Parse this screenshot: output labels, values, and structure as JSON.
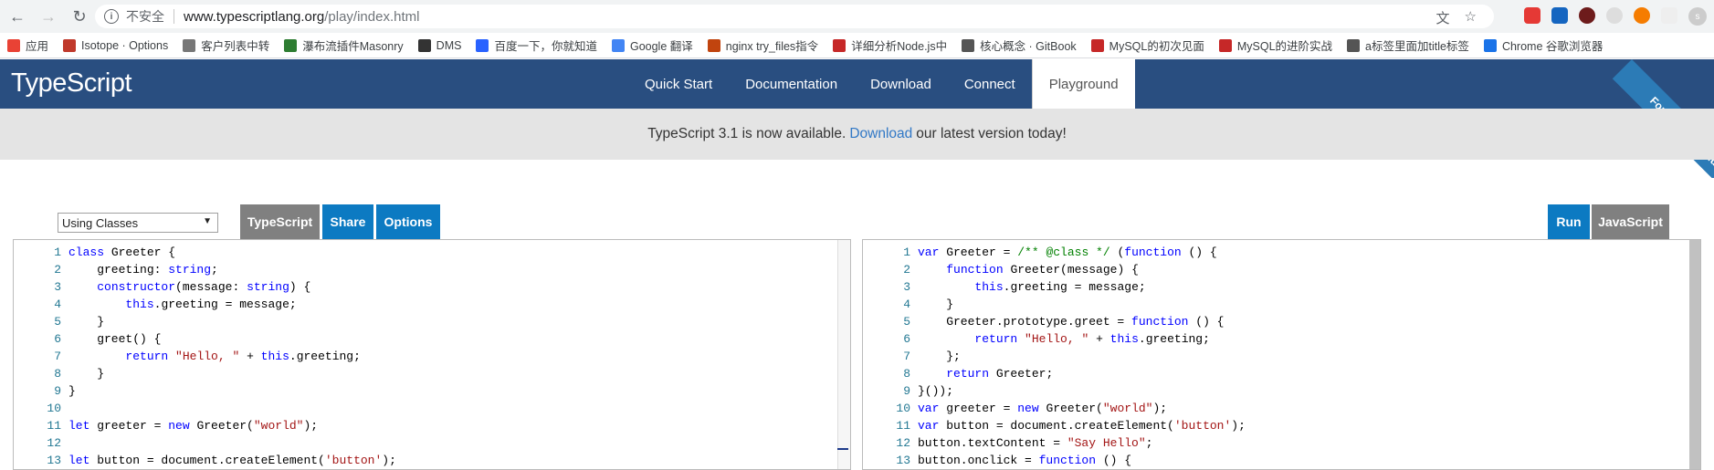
{
  "browser": {
    "insecure_label": "不安全",
    "url_host": "www.typescriptlang.org",
    "url_path": "/play/index.html",
    "avatar_letter": "s"
  },
  "bookmarks": [
    {
      "label": "应用",
      "color": "#e94235"
    },
    {
      "label": "Isotope · Options",
      "color": "#c0392b"
    },
    {
      "label": "客户列表中转",
      "color": "#777777"
    },
    {
      "label": "瀑布流插件Masonry",
      "color": "#2e7d32"
    },
    {
      "label": "DMS",
      "color": "#333333"
    },
    {
      "label": "百度一下，你就知道",
      "color": "#2962ff"
    },
    {
      "label": "Google 翻译",
      "color": "#4285f4"
    },
    {
      "label": "nginx try_files指令",
      "color": "#c1440e"
    },
    {
      "label": "详细分析Node.js中",
      "color": "#c62828"
    },
    {
      "label": "核心概念 · GitBook",
      "color": "#555555"
    },
    {
      "label": "MySQL的初次见面",
      "color": "#c62828"
    },
    {
      "label": "MySQL的进阶实战",
      "color": "#c62828"
    },
    {
      "label": "a标签里面加title标签",
      "color": "#555555"
    },
    {
      "label": "Chrome 谷歌浏览器",
      "color": "#1a73e8"
    }
  ],
  "site": {
    "logo": "TypeScript",
    "nav": [
      "Quick Start",
      "Documentation",
      "Download",
      "Connect",
      "Playground"
    ],
    "fork_ribbon": "Fork me on GitHub"
  },
  "announcement": {
    "before": "TypeScript 3.1 is now available.",
    "link": "Download",
    "after": "our latest version today!"
  },
  "toolbar": {
    "example_select": "Using Classes",
    "left_buttons": [
      "TypeScript",
      "Share",
      "Options"
    ],
    "right_buttons": [
      "Run",
      "JavaScript"
    ]
  },
  "ts_code": [
    {
      "n": "1",
      "t": "class Greeter {"
    },
    {
      "n": "2",
      "t": "    greeting: string;"
    },
    {
      "n": "3",
      "t": "    constructor(message: string) {"
    },
    {
      "n": "4",
      "t": "        this.greeting = message;"
    },
    {
      "n": "5",
      "t": "    }"
    },
    {
      "n": "6",
      "t": "    greet() {"
    },
    {
      "n": "7",
      "t": "        return \"Hello, \" + this.greeting;"
    },
    {
      "n": "8",
      "t": "    }"
    },
    {
      "n": "9",
      "t": "}"
    },
    {
      "n": "10",
      "t": ""
    },
    {
      "n": "11",
      "t": "let greeter = new Greeter(\"world\");"
    },
    {
      "n": "12",
      "t": ""
    },
    {
      "n": "13",
      "t": "let button = document.createElement('button');"
    }
  ],
  "js_code": [
    {
      "n": "1",
      "t": "var Greeter = /** @class */ (function () {"
    },
    {
      "n": "2",
      "t": "    function Greeter(message) {"
    },
    {
      "n": "3",
      "t": "        this.greeting = message;"
    },
    {
      "n": "4",
      "t": "    }"
    },
    {
      "n": "5",
      "t": "    Greeter.prototype.greet = function () {"
    },
    {
      "n": "6",
      "t": "        return \"Hello, \" + this.greeting;"
    },
    {
      "n": "7",
      "t": "    };"
    },
    {
      "n": "8",
      "t": "    return Greeter;"
    },
    {
      "n": "9",
      "t": "}());"
    },
    {
      "n": "10",
      "t": "var greeter = new Greeter(\"world\");"
    },
    {
      "n": "11",
      "t": "var button = document.createElement('button');"
    },
    {
      "n": "12",
      "t": "button.textContent = \"Say Hello\";"
    },
    {
      "n": "13",
      "t": "button.onclick = function () {"
    }
  ]
}
